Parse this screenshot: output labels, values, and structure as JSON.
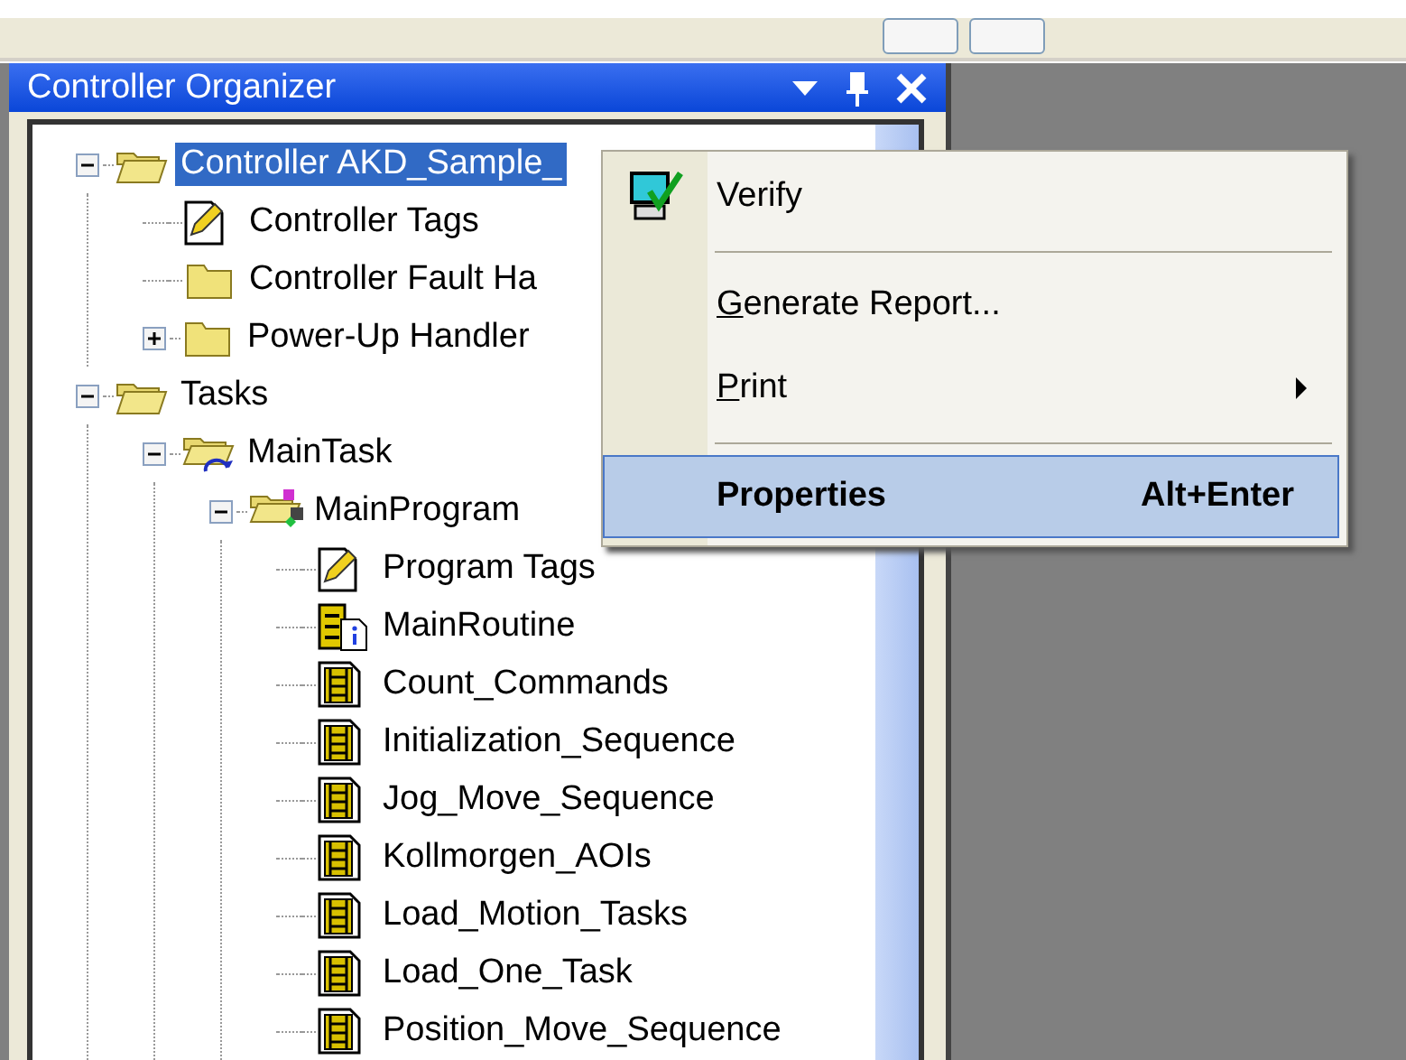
{
  "panel": {
    "title": "Controller Organizer"
  },
  "tree": [
    {
      "label": "Controller AKD_Sample_",
      "kind": "open_folder",
      "expanded": true,
      "selected": true,
      "children": [
        {
          "label": "Controller Tags",
          "kind": "tags",
          "selected": false
        },
        {
          "label": "Controller Fault Ha",
          "kind": "folder",
          "selected": false
        },
        {
          "label": "Power-Up Handler",
          "kind": "folder",
          "expanded": false,
          "selected": false
        }
      ]
    },
    {
      "label": "Tasks",
      "kind": "open_folder",
      "expanded": true,
      "selected": false,
      "children": [
        {
          "label": "MainTask",
          "kind": "task",
          "expanded": true,
          "selected": false,
          "children": [
            {
              "label": "MainProgram",
              "kind": "program",
              "expanded": true,
              "selected": false,
              "children": [
                {
                  "label": "Program Tags",
                  "kind": "tags",
                  "selected": false
                },
                {
                  "label": "MainRoutine",
                  "kind": "main_routine",
                  "selected": false
                },
                {
                  "label": "Count_Commands",
                  "kind": "routine",
                  "selected": false
                },
                {
                  "label": "Initialization_Sequence",
                  "kind": "routine",
                  "selected": false
                },
                {
                  "label": "Jog_Move_Sequence",
                  "kind": "routine",
                  "selected": false
                },
                {
                  "label": "Kollmorgen_AOIs",
                  "kind": "routine",
                  "selected": false
                },
                {
                  "label": "Load_Motion_Tasks",
                  "kind": "routine",
                  "selected": false
                },
                {
                  "label": "Load_One_Task",
                  "kind": "routine",
                  "selected": false
                },
                {
                  "label": "Position_Move_Sequence",
                  "kind": "routine",
                  "selected": false
                }
              ]
            }
          ]
        }
      ]
    }
  ],
  "context_menu": [
    {
      "kind": "item",
      "label": "Verify",
      "icon": true,
      "selected": false
    },
    {
      "kind": "separator"
    },
    {
      "kind": "item",
      "label": "Generate Report...",
      "underline_first": true,
      "selected": false
    },
    {
      "kind": "item",
      "label": "Print",
      "underline_first": true,
      "submenu": true,
      "selected": false
    },
    {
      "kind": "separator"
    },
    {
      "kind": "item",
      "label": "Properties",
      "shortcut": "Alt+Enter",
      "bold": true,
      "selected": true
    }
  ]
}
